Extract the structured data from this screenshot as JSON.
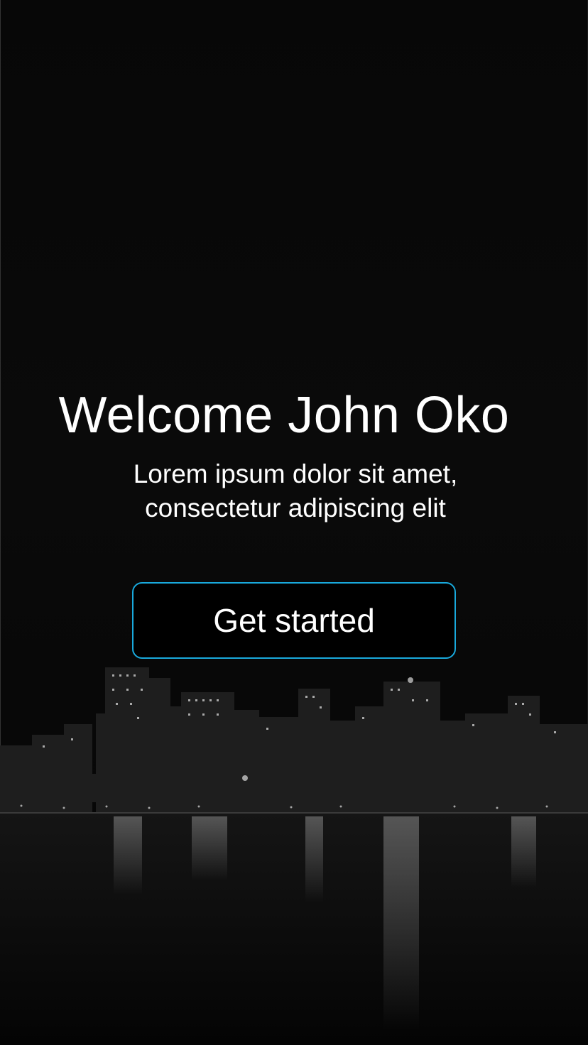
{
  "welcome": {
    "title": "Welcome John Oko",
    "subtitle_line1": "Lorem ipsum dolor sit amet,",
    "subtitle_line2": "consectetur adipiscing elit"
  },
  "cta": {
    "label": "Get started",
    "border_color": "#19a9dc"
  },
  "background": {
    "image": "night-city-skyline"
  }
}
